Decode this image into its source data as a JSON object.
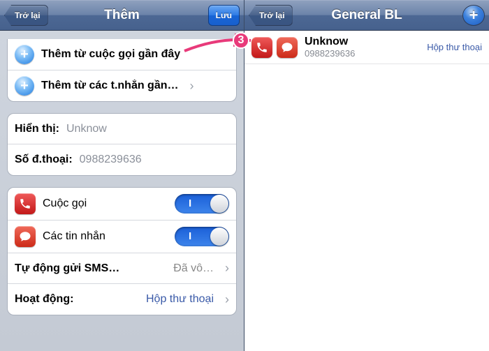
{
  "annotation": {
    "number": "3"
  },
  "left": {
    "nav": {
      "back": "Trở lại",
      "title": "Thêm",
      "save": "Lưu"
    },
    "addSection": {
      "fromCalls": "Thêm từ cuộc gọi gần đây",
      "fromMessages": "Thêm từ các t.nhắn gần…"
    },
    "fields": {
      "displayLabel": "Hiển thị:",
      "displayValue": "Unknow",
      "phoneLabel": "Số đ.thoại:",
      "phoneValue": "0988239636"
    },
    "toggles": {
      "call": "Cuộc gọi",
      "message": "Các tin nhắn"
    },
    "options": {
      "autoSmsLabel": "Tự động gửi SMS…",
      "autoSmsValue": "Đã vô…",
      "activityLabel": "Hoạt động:",
      "activityValue": "Hộp thư thoại"
    }
  },
  "right": {
    "nav": {
      "back": "Trở lại",
      "title": "General BL"
    },
    "entry": {
      "name": "Unknow",
      "number": "0988239636",
      "detail": "Hộp thư thoại"
    }
  }
}
